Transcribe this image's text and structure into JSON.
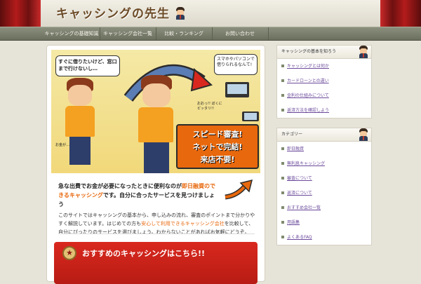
{
  "header": {
    "site_title": "キャッシングの先生"
  },
  "nav": {
    "items": [
      {
        "label": "キャッシングの基礎知識"
      },
      {
        "label": "キャッシング会社一覧"
      },
      {
        "label": "比較・ランキング"
      },
      {
        "label": "お問い合わせ"
      }
    ]
  },
  "banner": {
    "bubble_left": "すぐに借りたいけど、窓口まで行けないし…",
    "bubble_right": "スマホやパソコンで借りられるなんて!",
    "small_left": "お金が…",
    "small_right": "おおっ!! ぼくにピッタリ!!",
    "speed_lines": [
      "スピード審査!",
      "ネットで完結!",
      "来店不要!"
    ]
  },
  "main": {
    "headline_pre": "急な出費でお金が必要になったときに便利なのが",
    "headline_hl": "即日融資のできるキャッシング",
    "headline_post": "です。自分に合ったサービスを見つけましょう",
    "body_pre": "このサイトではキャッシングの基本から、申し込みの流れ、審査のポイントまで分かりやすく解説しています。はじめての方も",
    "body_hl": "安心して利用できるキャッシング会社",
    "body_post": "を比較して、自分にぴったりのサービスを選びましょう。わからないことがあればお気軽にどうぞ。",
    "red_title": "おすすめのキャッシングはこちら!!"
  },
  "sidebar": {
    "box1": {
      "title": "キャッシングの基本を知ろう",
      "items": [
        {
          "label": "キャッシングとは何か"
        },
        {
          "label": "カードローンとの違い"
        },
        {
          "label": "金利の仕組みについて"
        },
        {
          "label": "返済方法を確認しよう"
        }
      ]
    },
    "box2": {
      "title": "カテゴリー",
      "items": [
        {
          "label": "即日融資"
        },
        {
          "label": "無利息キャッシング"
        },
        {
          "label": "審査について"
        },
        {
          "label": "返済について"
        },
        {
          "label": "おすすめ会社一覧"
        },
        {
          "label": "用語集"
        },
        {
          "label": "よくあるFAQ"
        }
      ]
    }
  }
}
